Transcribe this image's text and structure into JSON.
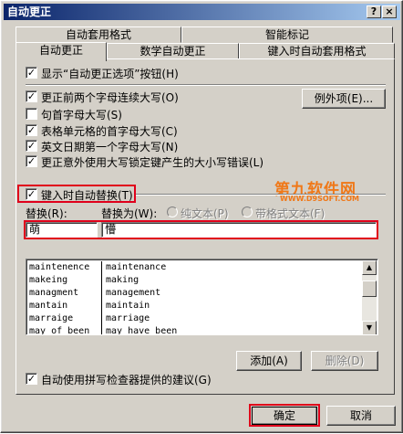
{
  "window": {
    "title": "自动更正",
    "help_btn": "?",
    "close_btn": "×"
  },
  "tabs_back": [
    "自动套用格式",
    "智能标记"
  ],
  "tabs_front": [
    "自动更正",
    "数学自动更正",
    "键入时自动套用格式"
  ],
  "options": {
    "show_buttons": "显示“自动更正选项”按钮(H)",
    "cap_two_initial": "更正前两个字母连续大写(O)",
    "cap_first_sentence": "句首字母大写(S)",
    "cap_first_table_cell": "表格单元格的首字母大写(C)",
    "cap_weekdays": "英文日期第一个字母大写(N)",
    "caps_lock_fix": "更正意外使用大写锁定键产生的大小写错误(L)",
    "exceptions_btn": "例外项(E)..."
  },
  "replace_section": {
    "replace_as_you_type": "键入时自动替换(T)",
    "replace_label": "替换(R):",
    "with_label": "替换为(W):",
    "plain_text": "纯文本(P)",
    "formatted_text": "带格式文本(F)",
    "replace_value": "萌",
    "with_value": "懵"
  },
  "entries": [
    [
      "maintenence",
      "maintenance"
    ],
    [
      "makeing",
      "making"
    ],
    [
      "managment",
      "management"
    ],
    [
      "mantain",
      "maintain"
    ],
    [
      "marraige",
      "marriage"
    ],
    [
      "may of been",
      "may have been"
    ]
  ],
  "buttons": {
    "add": "添加(A)",
    "delete": "删除(D)",
    "ok": "确定",
    "cancel": "取消"
  },
  "spell_checker": "自动使用拼写检查器提供的建议(G)",
  "watermark": {
    "logo": "第九软件网",
    "url": "WWW.D9SOFT.COM"
  },
  "colors": {
    "title_start": "#0a246a",
    "title_end": "#a6caf0",
    "highlight": "#e0001b",
    "face": "#d4d0c8"
  }
}
